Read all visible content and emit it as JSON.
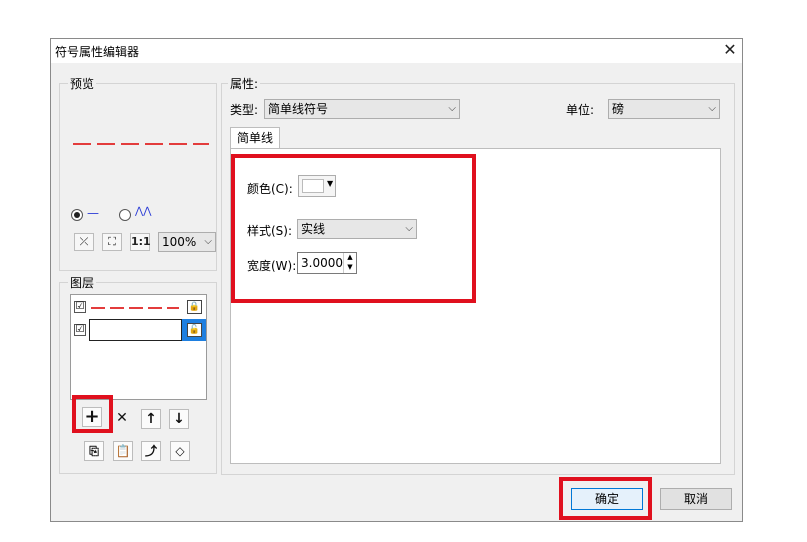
{
  "dialog": {
    "title": "符号属性编辑器",
    "close_glyph": "✕"
  },
  "preview": {
    "label": "预览",
    "line_color": "#e33c3c",
    "radio_line_glyph": "—",
    "radio_wave_glyph": "⋀⋀",
    "zoom_value": "100%"
  },
  "layers": {
    "label": "图层",
    "items": [
      {
        "checked": "☑",
        "type": "dashed-line"
      },
      {
        "checked": "☑",
        "type": "simple-line"
      }
    ]
  },
  "properties": {
    "label": "属性:",
    "type_label": "类型:",
    "type_value": "简单线符号",
    "unit_label": "单位:",
    "unit_value": "磅",
    "tab_label": "简单线",
    "color_label": "颜色(C):",
    "style_label": "样式(S):",
    "style_value": "实线",
    "width_label": "宽度(W):",
    "width_value": "3.0000"
  },
  "buttons": {
    "ok": "确定",
    "cancel": "取消"
  },
  "highlight_color": "#e0101e"
}
